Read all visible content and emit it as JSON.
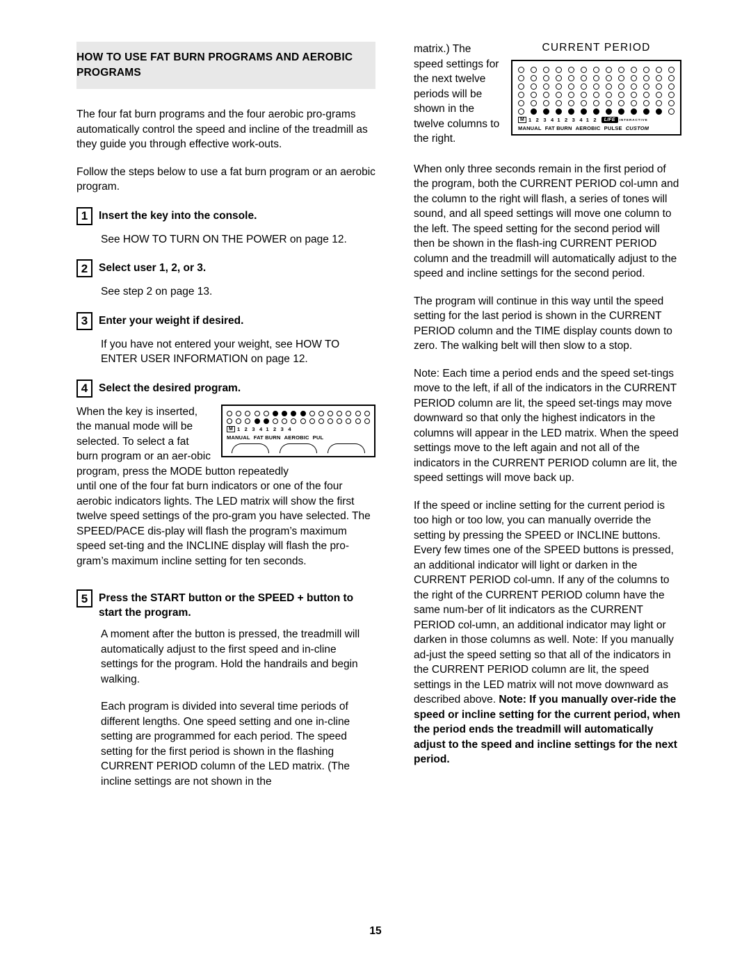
{
  "document": {
    "page_number": "15",
    "section_title": "HOW TO USE FAT BURN PROGRAMS AND AEROBIC PROGRAMS",
    "left_column": {
      "intro_paragraph_1": "The four fat burn programs and the four aerobic pro-grams automatically control the speed and incline of the treadmill as they guide you through effective work-outs.",
      "intro_paragraph_2": "Follow the steps below to use a fat burn program or an aerobic program.",
      "steps": [
        {
          "number": "1",
          "title": "Insert the key into the console.",
          "body": "See HOW TO TURN ON THE POWER on page 12."
        },
        {
          "number": "2",
          "title": "Select user 1, 2, or 3.",
          "body": "See step 2 on page 13."
        },
        {
          "number": "3",
          "title": "Enter your weight if desired.",
          "body": "If you have not entered your weight, see HOW TO ENTER USER INFORMATION on page 12."
        },
        {
          "number": "4",
          "title": "Select the desired program.",
          "body_wrap": "When the key is inserted, the manual mode will be selected. To select a fat burn program or an aer-obic program, press the MODE button repeatedly",
          "body_rest": "until one of the four fat burn indicators or one of the four aerobic indicators lights. The LED matrix will show the first twelve speed settings of the pro-gram you have selected. The SPEED/PACE dis-play will flash the program’s maximum speed set-ting and the INCLINE display will flash the pro-gram’s maximum incline setting for ten seconds."
        },
        {
          "number": "5",
          "title": "Press the START button or the SPEED + button to start the program.",
          "body_1": "A moment after the button is pressed, the treadmill will automatically adjust to the first speed and in-cline settings for the program. Hold the handrails and begin walking.",
          "body_2": "Each program is divided into several time periods of different lengths. One speed setting and one in-cline setting are programmed for each period. The speed setting for the first period is shown in the flashing CURRENT PERIOD column of the LED matrix. (The incline settings are not shown in the"
        }
      ]
    },
    "right_column": {
      "wrap_text": "matrix.) The speed settings for the next twelve periods will be shown in the twelve columns to the right.",
      "figure_caption": "CURRENT PERIOD",
      "paragraphs": [
        "When only three seconds remain in the first period of the program, both the CURRENT PERIOD col-umn and the column to the right will flash, a series of tones will sound, and all speed settings will move one column to the left. The speed setting for the second period will then be shown in the flash-ing CURRENT PERIOD column and the treadmill will automatically adjust to the speed and incline settings for the second period.",
        "The program will continue in this way until the speed setting for the last period is shown in the CURRENT PERIOD column and the TIME display counts down to zero. The walking belt will then slow to a stop.",
        "Note: Each time a period ends and the speed set-tings move to the left, if all of the indicators in the CURRENT PERIOD column are lit, the speed set-tings may move downward so that only the highest indicators in the columns will appear in the LED matrix. When the speed settings move to the left again and not all of the indicators in the CURRENT PERIOD column are lit, the speed settings will move back up."
      ],
      "final_paragraph_normal": "If the speed or incline setting for the current period is too high or too low, you can manually override the setting by pressing the SPEED or INCLINE buttons. Every few times one of the SPEED buttons is pressed, an additional indicator will light or darken in the CURRENT PERIOD col-umn. If any of the columns to the right of the CURRENT PERIOD column have the same num-ber of lit indicators as the CURRENT PERIOD col-umn, an additional indicator may light or darken in those columns as well. Note: If you manually ad-just the speed setting so that all of the indicators in the CURRENT PERIOD column are lit, the speed settings in the LED matrix will not move downward as described above. ",
      "final_paragraph_bold": "Note: If you manually over-ride the speed or incline setting for the current period, when the period ends the treadmill will automatically adjust to the speed and incline settings for the next period."
    },
    "console_labels": {
      "mode_box": "M",
      "manual": "MANUAL",
      "fat_burn": "FAT BURN",
      "aerobic": "AEROBIC",
      "pulse": "PULSE",
      "custom": "CUSTOM",
      "pulse_truncated": "PUL",
      "nums_1": "1 2 3 4",
      "nums_2": "1 2 3 4",
      "nums_3": "1 2",
      "logo": "LIFE",
      "logo_sub": "INTERACTIVE"
    }
  }
}
